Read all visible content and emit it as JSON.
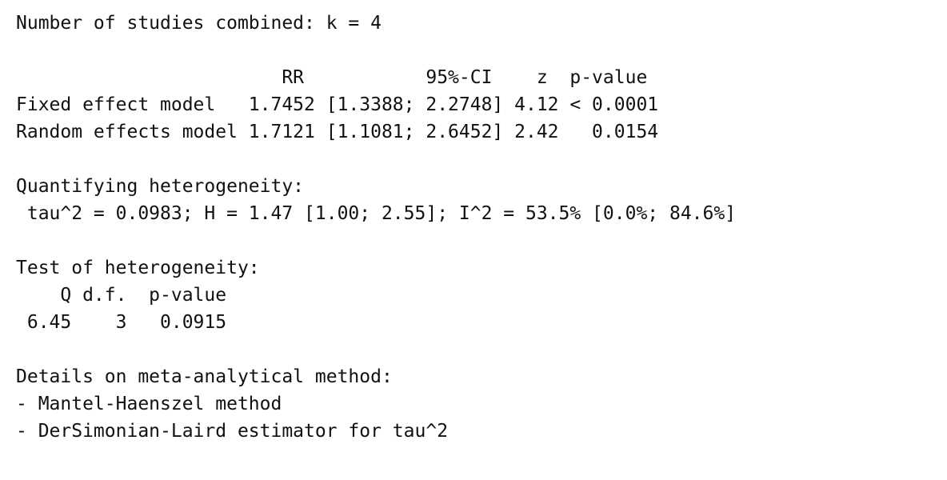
{
  "output": {
    "lines": [
      "Number of studies combined: k = 4",
      "",
      "                        RR           95%-CI    z  p-value",
      "Fixed effect model   1.7452 [1.3388; 2.2748] 4.12 < 0.0001",
      "Random effects model 1.7121 [1.1081; 2.6452] 2.42   0.0154",
      "",
      "Quantifying heterogeneity:",
      " tau^2 = 0.0983; H = 1.47 [1.00; 2.55]; I^2 = 53.5% [0.0%; 84.6%]",
      "",
      "Test of heterogeneity:",
      "    Q d.f.  p-value",
      " 6.45    3   0.0915",
      "",
      "Details on meta-analytical method:",
      "- Mantel-Haenszel method",
      "- DerSimonian-Laird estimator for tau^2"
    ]
  }
}
